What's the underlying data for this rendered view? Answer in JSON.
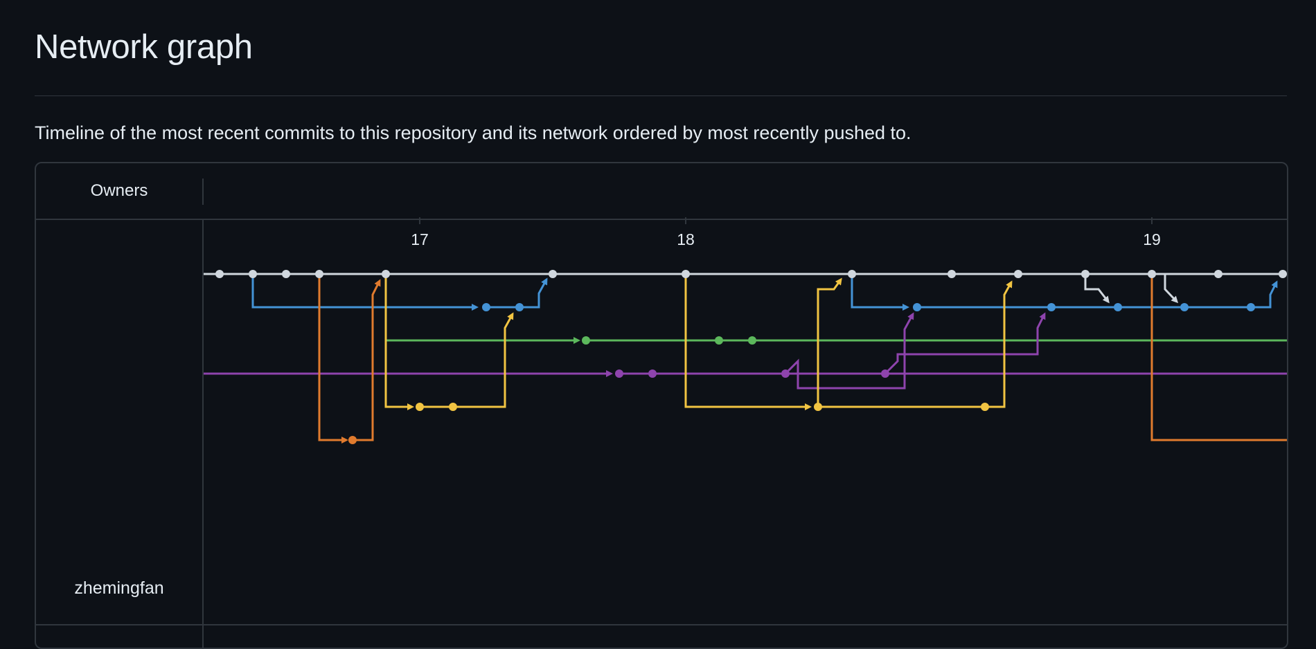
{
  "page": {
    "title": "Network graph",
    "description": "Timeline of the most recent commits to this repository and its network ordered by most recently pushed to."
  },
  "graph": {
    "owners_header": "Owners",
    "owner": "zhemingfan",
    "date_ticks": [
      "17",
      "18",
      "19"
    ]
  },
  "colors": {
    "background": "#0d1117",
    "border": "#30363d",
    "main": "#d0d7de",
    "blue": "#4493d6",
    "orange": "#e07b2e",
    "yellow": "#f1c442",
    "green": "#5cb85c",
    "purple": "#8e44ad"
  }
}
